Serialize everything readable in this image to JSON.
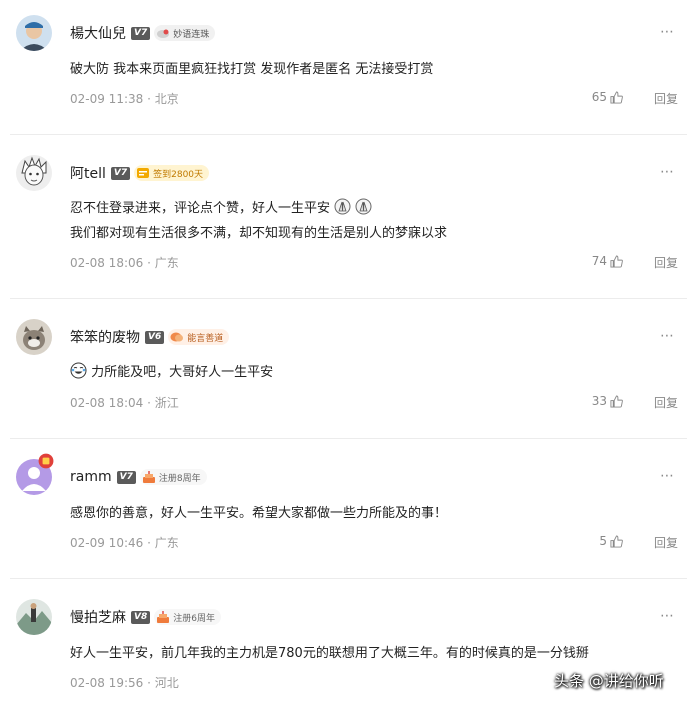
{
  "comments": [
    {
      "username": "楊大仙兒",
      "level": "V7",
      "badge": "妙语连珠",
      "lines": [
        "破大防 我本来页面里疯狂找打赏 发现作者是匿名 无法接受打赏"
      ],
      "date": "02-09 11:38 · 北京",
      "likes": "65",
      "reply": "回复"
    },
    {
      "username": "阿tell",
      "level": "V7",
      "badge": "签到2800天",
      "lines": [
        "忍不住登录进来，评论点个赞，好人一生平安",
        "我们都对现有生活很多不满，却不知现有的生活是别人的梦寐以求"
      ],
      "date": "02-08 18:06 · 广东",
      "likes": "74",
      "reply": "回复"
    },
    {
      "username": "笨笨的废物",
      "level": "V6",
      "badge": "能言善道",
      "lines": [
        "力所能及吧，大哥好人一生平安"
      ],
      "date": "02-08 18:04 · 浙江",
      "likes": "33",
      "reply": "回复"
    },
    {
      "username": "ramm",
      "level": "V7",
      "badge": "注册8周年",
      "lines": [
        "感恩你的善意，好人一生平安。希望大家都做一些力所能及的事！"
      ],
      "date": "02-09 10:46 · 广东",
      "likes": "5",
      "reply": "回复"
    },
    {
      "username": "慢拍芝麻",
      "level": "V8",
      "badge": "注册6周年",
      "lines": [
        "好人一生平安，前几年我的主力机是780元的联想用了大概三年。有的时候真的是一分钱掰"
      ],
      "date": "02-08 19:56 · 河北",
      "likes": "",
      "reply": ""
    }
  ],
  "more_icon": "⋯",
  "watermark": "头条 @讲给你听",
  "icons": {
    "like": "thumbs-up-icon",
    "more": "more-dots-icon"
  },
  "colors": {
    "text": "#222222",
    "meta": "#999999",
    "divider": "#ececec",
    "level_badge": "#5a5a5a"
  }
}
